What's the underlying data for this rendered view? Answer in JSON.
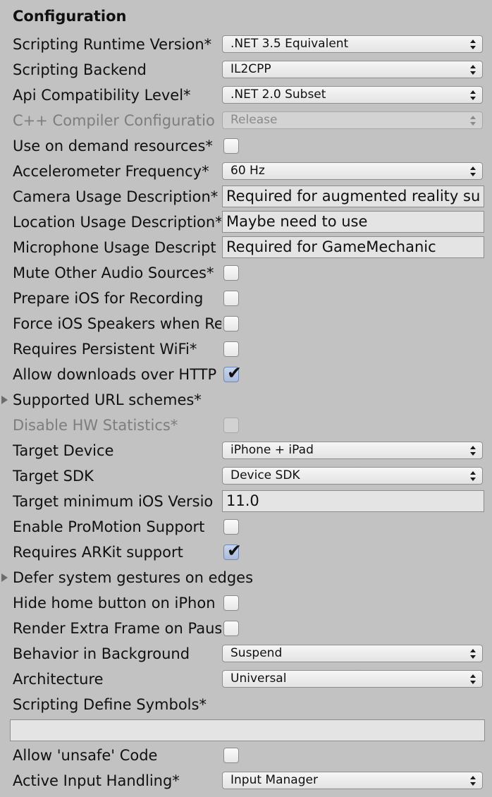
{
  "section_title": "Configuration",
  "rows": {
    "scripting_runtime": {
      "label": "Scripting Runtime Version*",
      "value": ".NET 3.5 Equivalent"
    },
    "scripting_backend": {
      "label": "Scripting Backend",
      "value": "IL2CPP"
    },
    "api_compat": {
      "label": "Api Compatibility Level*",
      "value": ".NET 2.0 Subset"
    },
    "cpp_compiler": {
      "label": "C++ Compiler Configuratio",
      "value": "Release"
    },
    "on_demand": {
      "label": "Use on demand resources*",
      "checked": false
    },
    "accelerometer": {
      "label": "Accelerometer Frequency*",
      "value": "60 Hz"
    },
    "camera_usage": {
      "label": "Camera Usage Description*",
      "value": "Required for augmented reality su"
    },
    "location_usage": {
      "label": "Location Usage Description*",
      "value": "Maybe need to use"
    },
    "microphone_usage": {
      "label": "Microphone Usage Descript",
      "value": "Required for GameMechanic"
    },
    "mute_audio": {
      "label": "Mute Other Audio Sources*",
      "checked": false
    },
    "prepare_recording": {
      "label": "Prepare iOS for Recording",
      "checked": false
    },
    "force_speakers": {
      "label": "Force iOS Speakers when Re",
      "checked": false
    },
    "persistent_wifi": {
      "label": "Requires Persistent WiFi*",
      "checked": false
    },
    "allow_http": {
      "label": "Allow downloads over HTTP",
      "checked": true
    },
    "url_schemes": {
      "label": "Supported URL schemes*"
    },
    "disable_hw_stats": {
      "label": "Disable HW Statistics*",
      "checked": false
    },
    "target_device": {
      "label": "Target Device",
      "value": "iPhone + iPad"
    },
    "target_sdk": {
      "label": "Target SDK",
      "value": "Device SDK"
    },
    "min_ios": {
      "label": "Target minimum iOS Versio",
      "value": "11.0"
    },
    "promotion": {
      "label": "Enable ProMotion Support",
      "checked": false
    },
    "arkit": {
      "label": "Requires ARKit support",
      "checked": true
    },
    "defer_gestures": {
      "label": "Defer system gestures on edges"
    },
    "hide_home": {
      "label": "Hide home button on iPhon",
      "checked": false
    },
    "extra_frame": {
      "label": "Render Extra Frame on Paus",
      "checked": false
    },
    "background_behavior": {
      "label": "Behavior in Background",
      "value": "Suspend"
    },
    "architecture": {
      "label": "Architecture",
      "value": "Universal"
    },
    "define_symbols": {
      "label": "Scripting Define Symbols*",
      "value": ""
    },
    "unsafe_code": {
      "label": "Allow 'unsafe' Code",
      "checked": false
    },
    "input_handling": {
      "label": "Active Input Handling*",
      "value": "Input Manager"
    }
  },
  "icons": {
    "dropdown_arrows": "up-down-arrows-icon",
    "checkmark": "✔",
    "foldout": "triangle-right-icon"
  },
  "colors": {
    "panel_background": "#c2c2c2",
    "disabled_text": "#7d7d7d",
    "checked_fill": "#b3c3e3"
  }
}
